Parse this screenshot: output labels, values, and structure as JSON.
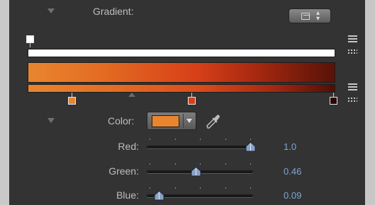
{
  "gradient_section": {
    "label": "Gradient:"
  },
  "color_section": {
    "label": "Color:",
    "swatch_color": "#e9852f"
  },
  "gradient_stops": {
    "stop_colors": [
      "#e9852f",
      "#d73f18",
      "#2a0603"
    ],
    "gradient_colors": [
      "#e9852f",
      "#e36b22",
      "#d73f18",
      "#a52810",
      "#581208"
    ]
  },
  "sliders": [
    {
      "label": "Red:",
      "value": "1.0",
      "fraction": 1.0
    },
    {
      "label": "Green:",
      "value": "0.46",
      "fraction": 0.46
    },
    {
      "label": "Blue:",
      "value": "0.09",
      "fraction": 0.09
    }
  ],
  "colors": {
    "panel_bg": "#333333",
    "value_text": "#7ea6d6",
    "label_text": "#bdbdbd"
  }
}
